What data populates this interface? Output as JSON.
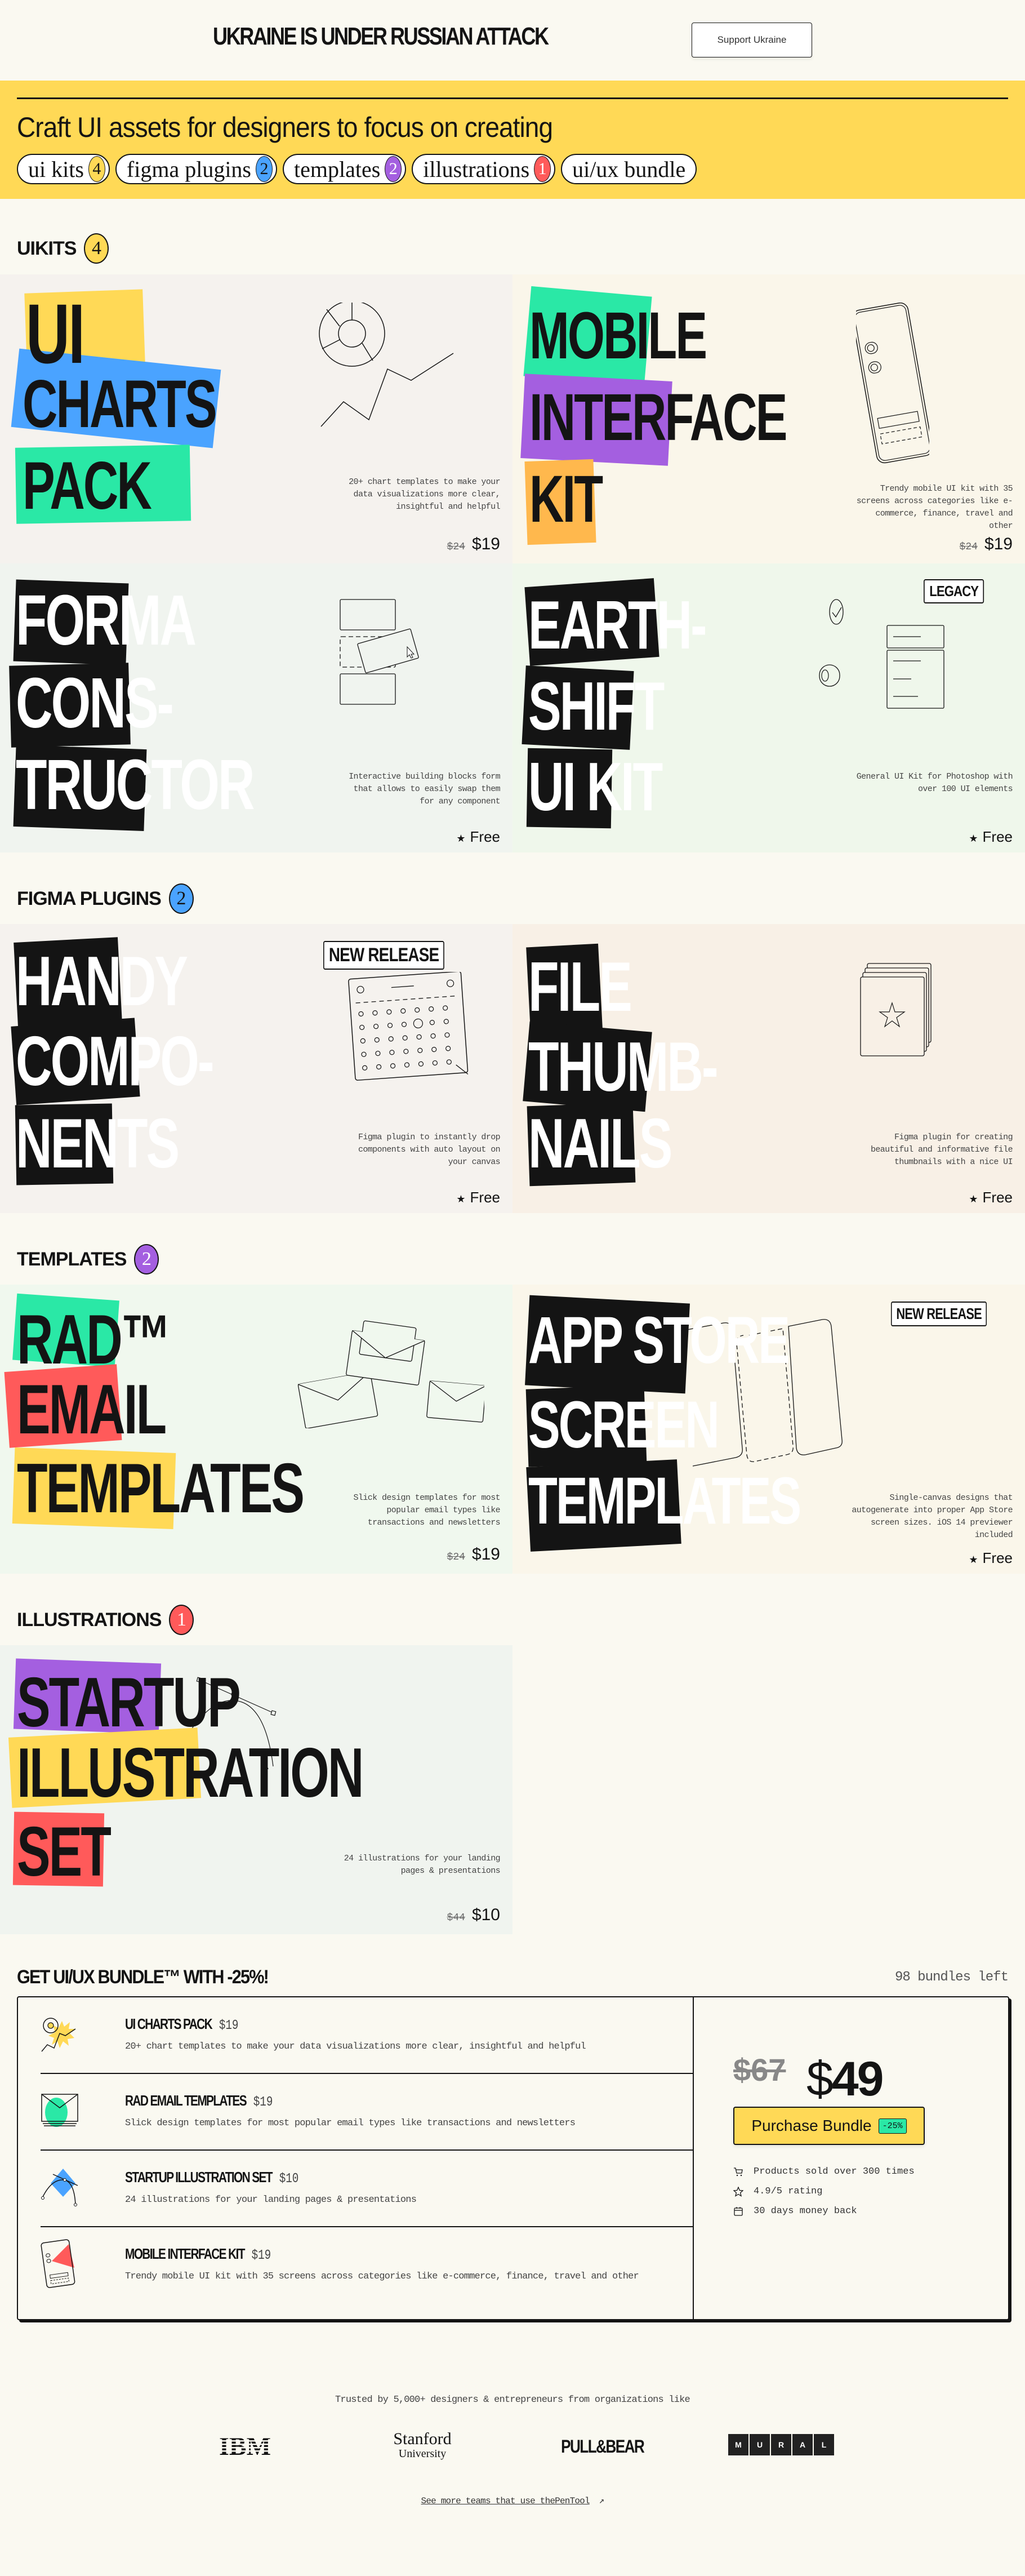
{
  "banner": {
    "title": "UKRAINE IS UNDER RUSSIAN ATTACK",
    "button": "Support Ukraine"
  },
  "hero": {
    "title": "Craft UI assets for designers to focus on creating",
    "chips": [
      {
        "label": "ui kits",
        "count": "4",
        "color": "#ffd956",
        "text_color": "#141414"
      },
      {
        "label": "figma plugins",
        "count": "2",
        "color": "#4aa3ff",
        "text_color": "#141414"
      },
      {
        "label": "templates",
        "count": "2",
        "color": "#a45fe0",
        "text_color": "#ffffff"
      },
      {
        "label": "illustrations",
        "count": "1",
        "color": "#ff5a5a",
        "text_color": "#ffffff"
      },
      {
        "label": "ui/ux bundle",
        "count": null
      }
    ]
  },
  "colors": {
    "yellow": "#ffd956",
    "blue": "#4aa3ff",
    "green": "#2ae8a6",
    "purple": "#a45fe0",
    "red": "#ff5a5a",
    "orange": "#ffb84d",
    "black": "#141414",
    "page_bg": "#faf9f1"
  },
  "sections": {
    "uikits": {
      "title": "UIKITS",
      "count": "4"
    },
    "figma": {
      "title": "FIGMA PLUGINS",
      "count": "2"
    },
    "templates": {
      "title": "TEMPLATES",
      "count": "2"
    },
    "illustrations": {
      "title": "ILLUSTRATIONS",
      "count": "1"
    }
  },
  "products": {
    "charts": {
      "lines": [
        "UI",
        "CHARTS",
        "PACK"
      ],
      "desc": "20+ chart templates to make your data visualizations more clear, insightful and helpful",
      "old_price": "$24",
      "price": "$19"
    },
    "mobile": {
      "lines": [
        "MOBILE",
        "INTERFACE",
        "KIT"
      ],
      "desc": "Trendy mobile UI kit with 35 screens across categories like e-commerce, finance, travel and other",
      "old_price": "$24",
      "price": "$19"
    },
    "forma": {
      "lines": [
        "FORMA",
        "CONS-",
        "TRUCTOR"
      ],
      "desc": "Interactive building blocks form that allows to easily swap them for any component",
      "price": "Free",
      "star": "★"
    },
    "earth": {
      "lines": [
        "EARTH-",
        "SHIFT",
        "UI KIT"
      ],
      "tag": "LEGACY",
      "desc": "General UI Kit for Photoshop with over 100 UI elements",
      "price": "Free",
      "star": "★"
    },
    "handy": {
      "lines": [
        "HANDY",
        "COMPO-",
        "NENTS"
      ],
      "tag": "NEW RELEASE",
      "desc": "Figma plugin to instantly drop components with auto layout on your canvas",
      "price": "Free",
      "star": "★"
    },
    "thumbs": {
      "lines": [
        "FILE",
        "THUMB-",
        "NAILS"
      ],
      "desc": "Figma plugin for creating beautiful and informative file thumbnails with a nice UI",
      "price": "Free",
      "star": "★"
    },
    "rad": {
      "lines": [
        "RAD™",
        "EMAIL",
        "TEMPLATES"
      ],
      "desc": "Slick design templates for most popular email types like transactions and newsletters",
      "old_price": "$24",
      "price": "$19"
    },
    "appstore": {
      "lines": [
        "APP STORE",
        "SCREEN",
        "TEMPLATES"
      ],
      "tag": "NEW RELEASE",
      "desc": "Single-canvas designs that autogenerate into proper App Store screen sizes. iOS 14 previewer included",
      "price": "Free",
      "star": "★"
    },
    "startup": {
      "lines": [
        "STARTUP",
        "ILLUSTRATION",
        "SET"
      ],
      "desc": "24 illustrations for your landing pages & presentations",
      "old_price": "$44",
      "price": "$10"
    }
  },
  "bundle": {
    "title": "GET UI/UX BUNDLE™ WITH -25%!",
    "left": "98  bundles left",
    "items": [
      {
        "name": "UI CHARTS PACK",
        "price": "$19",
        "desc": "20+ chart templates to make your data visualizations more clear, insightful and helpful",
        "icon": "chart-icon"
      },
      {
        "name": "RAD EMAIL TEMPLATES",
        "price": "$19",
        "desc": "Slick design templates for most popular email types like transactions and newsletters",
        "icon": "envelope-icon"
      },
      {
        "name": "STARTUP ILLUSTRATION SET",
        "price": "$10",
        "desc": "24 illustrations for your landing pages & presentations",
        "icon": "pen-tool-icon"
      },
      {
        "name": "MOBILE INTERFACE KIT",
        "price": "$19",
        "desc": "Trendy mobile UI kit with 35 screens across categories like e-commerce, finance, travel and other",
        "icon": "phone-icon"
      }
    ],
    "old_price": "$67",
    "price_symbol": "$",
    "price_value": "49",
    "button": "Purchase Bundle",
    "discount": "-25%",
    "perks": [
      {
        "icon": "cart-icon",
        "text": "Products sold over 300 times"
      },
      {
        "icon": "star-icon",
        "text": "4.9/5 rating"
      },
      {
        "icon": "calendar-icon",
        "text": "30 days money back"
      }
    ]
  },
  "trusted": {
    "text": "Trusted by 5,000+ designers & entrepreneurs from organizations like",
    "logos": [
      "IBM",
      "Stanford",
      "University",
      "PULL&BEAR",
      "MURAL"
    ],
    "link": "See more teams that use thePenTool",
    "link_arrow": "↗"
  }
}
